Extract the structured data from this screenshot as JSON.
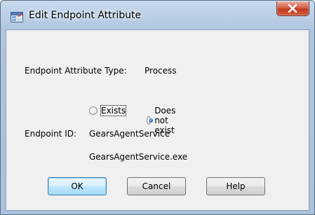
{
  "window": {
    "title": "Edit Endpoint Attribute",
    "icon": "app-icon",
    "close_icon": "close-icon"
  },
  "form": {
    "attribute_type_label": "Endpoint Attribute Type:",
    "attribute_type_value": "Process",
    "radios": [
      {
        "label": "Exists",
        "checked": false
      },
      {
        "label": "Does not exist",
        "checked": true
      }
    ],
    "endpoint_id_label": "Endpoint ID:",
    "endpoint_id_line1": "GearsAgentService",
    "endpoint_id_line2": "GearsAgentService.exe"
  },
  "buttons": {
    "ok": "OK",
    "cancel": "Cancel",
    "help": "Help"
  },
  "colors": {
    "title_bar": "#b6cbe3",
    "close_button": "#c13a1f",
    "client_background": "#f0f0f0",
    "default_button_border": "#3c7fb1"
  }
}
